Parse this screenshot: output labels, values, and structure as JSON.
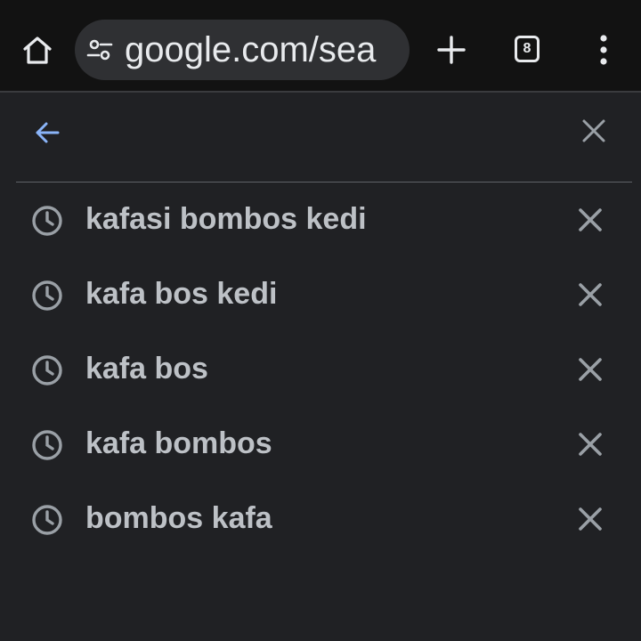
{
  "toolbar": {
    "url": "google.com/sea",
    "tab_count": "8",
    "home_icon": "home-icon",
    "site_info_icon": "tune-icon",
    "new_tab_icon": "plus-icon",
    "menu_icon": "more-vert-icon"
  },
  "search": {
    "query": "",
    "back_icon": "arrow-back-icon",
    "clear_icon": "close-icon"
  },
  "suggestions": [
    {
      "text": "kafasi bombos kedi",
      "icon": "history-icon"
    },
    {
      "text": "kafa bos kedi",
      "icon": "history-icon"
    },
    {
      "text": "kafa bos",
      "icon": "history-icon"
    },
    {
      "text": "kafa bombos",
      "icon": "history-icon"
    },
    {
      "text": "bombos kafa",
      "icon": "history-icon"
    }
  ],
  "colors": {
    "background": "#202124",
    "toolbar": "#121212",
    "urlbar": "#2f3033",
    "accent_blue": "#8ab4f8",
    "text": "#bdc1c6",
    "icon_gray": "#9aa0a6"
  }
}
